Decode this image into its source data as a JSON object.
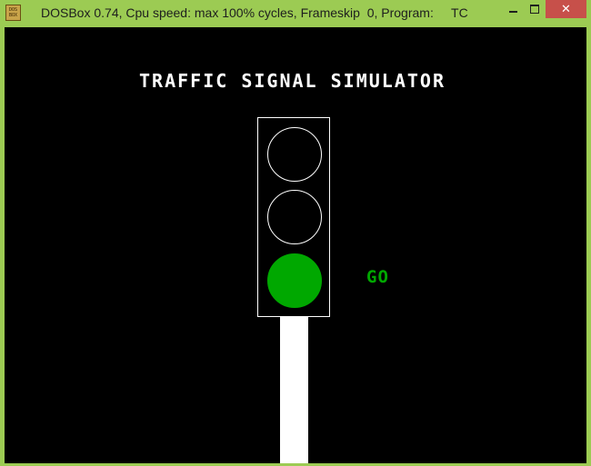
{
  "window": {
    "title": "DOSBox 0.74, Cpu speed: max 100% cycles, Frameskip  0, Program:     TC",
    "icon_label": "DOS BOX",
    "icon": "dosbox-app-icon",
    "buttons": {
      "minimize": "minimize-icon",
      "maximize": "maximize-icon",
      "close_glyph": "✕"
    }
  },
  "screen": {
    "heading": "TRAFFIC SIGNAL SIMULATOR",
    "signal": {
      "active_light": "green",
      "lights": [
        {
          "name": "red",
          "state": "off",
          "color": "#000000"
        },
        {
          "name": "yellow",
          "state": "off",
          "color": "#000000"
        },
        {
          "name": "green",
          "state": "on",
          "color": "#00a800"
        }
      ]
    },
    "status": "GO",
    "status_color": "#00a800"
  },
  "colors": {
    "frame": "#9ccb53",
    "close_button": "#c7504a",
    "screen_bg": "#000000",
    "text": "#ffffff"
  }
}
